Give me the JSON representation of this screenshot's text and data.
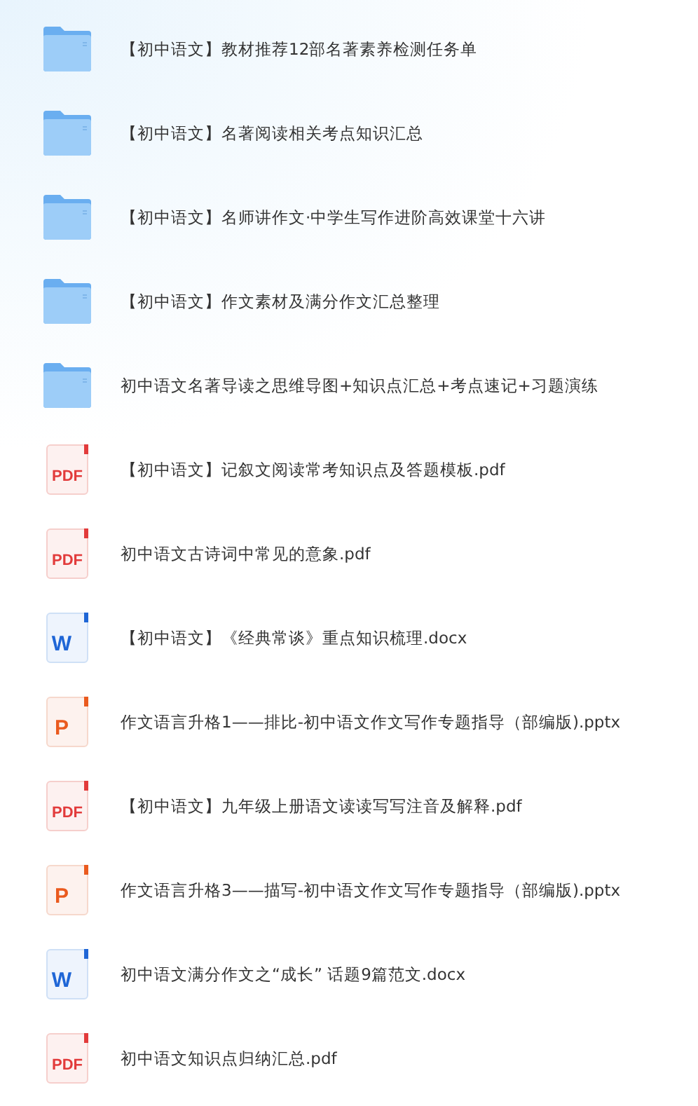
{
  "files": [
    {
      "kind": "folder",
      "name": "【初中语文】教材推荐12部名著素养检测任务单"
    },
    {
      "kind": "folder",
      "name": "【初中语文】名著阅读相关考点知识汇总"
    },
    {
      "kind": "folder",
      "name": "【初中语文】名师讲作文·中学生写作进阶高效课堂十六讲"
    },
    {
      "kind": "folder",
      "name": "【初中语文】作文素材及满分作文汇总整理"
    },
    {
      "kind": "folder",
      "name": "初中语文名著导读之思维导图+知识点汇总+考点速记+习题演练"
    },
    {
      "kind": "pdf",
      "icon_label": "PDF",
      "name": "【初中语文】记叙文阅读常考知识点及答题模板.pdf"
    },
    {
      "kind": "pdf",
      "icon_label": "PDF",
      "name": "初中语文古诗词中常见的意象.pdf"
    },
    {
      "kind": "word",
      "icon_label": "W",
      "name": "【初中语文】《经典常谈》重点知识梳理.docx"
    },
    {
      "kind": "ppt",
      "icon_label": "P",
      "name": "作文语言升格1——排比-初中语文作文写作专题指导（部编版).pptx"
    },
    {
      "kind": "pdf",
      "icon_label": "PDF",
      "name": "【初中语文】九年级上册语文读读写写注音及解释.pdf"
    },
    {
      "kind": "ppt",
      "icon_label": "P",
      "name": "作文语言升格3——描写-初中语文作文写作专题指导（部编版).pptx"
    },
    {
      "kind": "word",
      "icon_label": "W",
      "name": "初中语文满分作文之“成长” 话题9篇范文.docx"
    },
    {
      "kind": "pdf",
      "icon_label": "PDF",
      "name": "初中语文知识点归纳汇总.pdf"
    }
  ]
}
